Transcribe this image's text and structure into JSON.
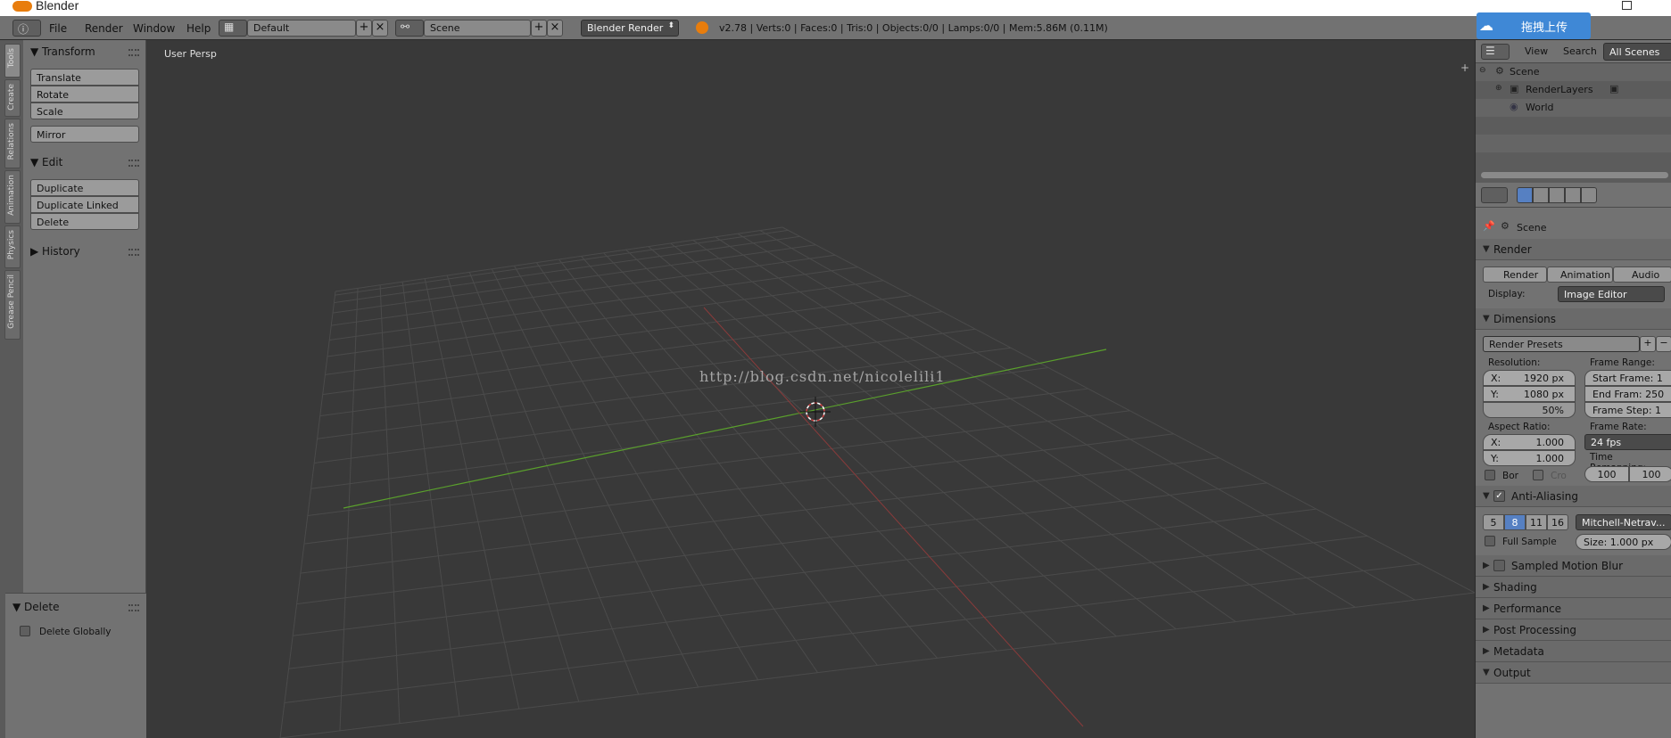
{
  "window": {
    "title": "Blender"
  },
  "menus": [
    "File",
    "Render",
    "Window",
    "Help"
  ],
  "screen_layout": "Default",
  "scene_field": "Scene",
  "render_engine": "Blender Render",
  "stats": "v2.78 | Verts:0 | Faces:0 | Tris:0 | Objects:0/0 | Lamps:0/0 | Mem:5.86M (0.11M)",
  "cloud_upload": "拖拽上传",
  "tool_tabs": [
    "Tools",
    "Create",
    "Relations",
    "Animation",
    "Physics",
    "Grease Pencil"
  ],
  "tools": {
    "transform_header": "Transform",
    "translate": "Translate",
    "rotate": "Rotate",
    "scale": "Scale",
    "mirror": "Mirror",
    "edit_header": "Edit",
    "duplicate": "Duplicate",
    "duplicate_linked": "Duplicate Linked",
    "delete": "Delete",
    "history_header": "History"
  },
  "operator": {
    "header": "Delete",
    "delete_globally": "Delete Globally"
  },
  "viewport": {
    "label": "User Persp",
    "watermark": "http://blog.csdn.net/nicolelili1"
  },
  "outliner": {
    "view": "View",
    "search": "Search",
    "all_scenes": "All Scenes",
    "items": [
      "Scene",
      "RenderLayers",
      "World"
    ]
  },
  "properties": {
    "context": "Scene",
    "render_header": "Render",
    "render_btn": "Render",
    "animation_btn": "Animation",
    "audio_btn": "Audio",
    "display_label": "Display:",
    "display_value": "Image Editor",
    "dimensions_header": "Dimensions",
    "render_presets": "Render Presets",
    "resolution_label": "Resolution:",
    "res_x": "1920 px",
    "res_y": "1080 px",
    "res_pct": "50%",
    "frame_range_label": "Frame Range:",
    "start_frame": "Start Frame:",
    "start_frame_val": "1",
    "end_frame": "End Fram:",
    "end_frame_val": "250",
    "frame_step": "Frame Step:",
    "frame_step_val": "1",
    "aspect_label": "Aspect Ratio:",
    "aspect_x": "1.000",
    "aspect_y": "1.000",
    "x_label": "X:",
    "y_label": "Y:",
    "frame_rate_label": "Frame Rate:",
    "frame_rate": "24 fps",
    "time_remap_label": "Time Remapping:",
    "remap_old": "100",
    "remap_new": "100",
    "border": "Bor",
    "crop": "Cro",
    "aa_header": "Anti-Aliasing",
    "aa_samples": [
      "5",
      "8",
      "11",
      "16"
    ],
    "aa_filter": "Mitchell-Netrav...",
    "full_sample": "Full Sample",
    "aa_size": "Size: 1.000 px",
    "motion_blur": "Sampled Motion Blur",
    "shading": "Shading",
    "performance": "Performance",
    "post_processing": "Post Processing",
    "metadata": "Metadata",
    "output": "Output"
  }
}
